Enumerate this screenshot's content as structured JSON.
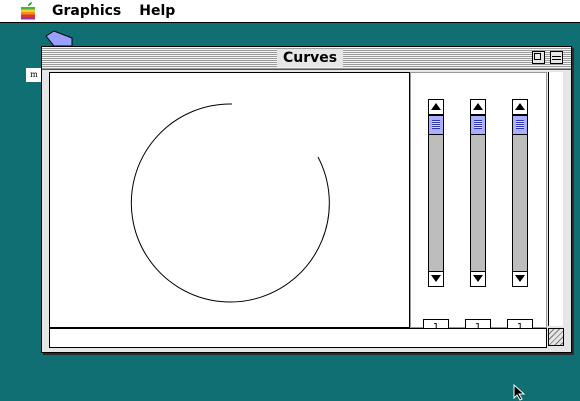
{
  "menubar": {
    "apple_icon": "apple-rainbow-logo",
    "items": [
      "Graphics",
      "Help"
    ]
  },
  "desktop": {
    "folder_icon": "folder-icon",
    "label": "m"
  },
  "window": {
    "title": "Curves",
    "canvas": {
      "curve": "arc"
    },
    "sliders": [
      {
        "value": "1"
      },
      {
        "value": "1"
      },
      {
        "value": "1"
      }
    ]
  },
  "colors": {
    "desktop": "#0f6f73",
    "thumb": "#aab0ff"
  }
}
